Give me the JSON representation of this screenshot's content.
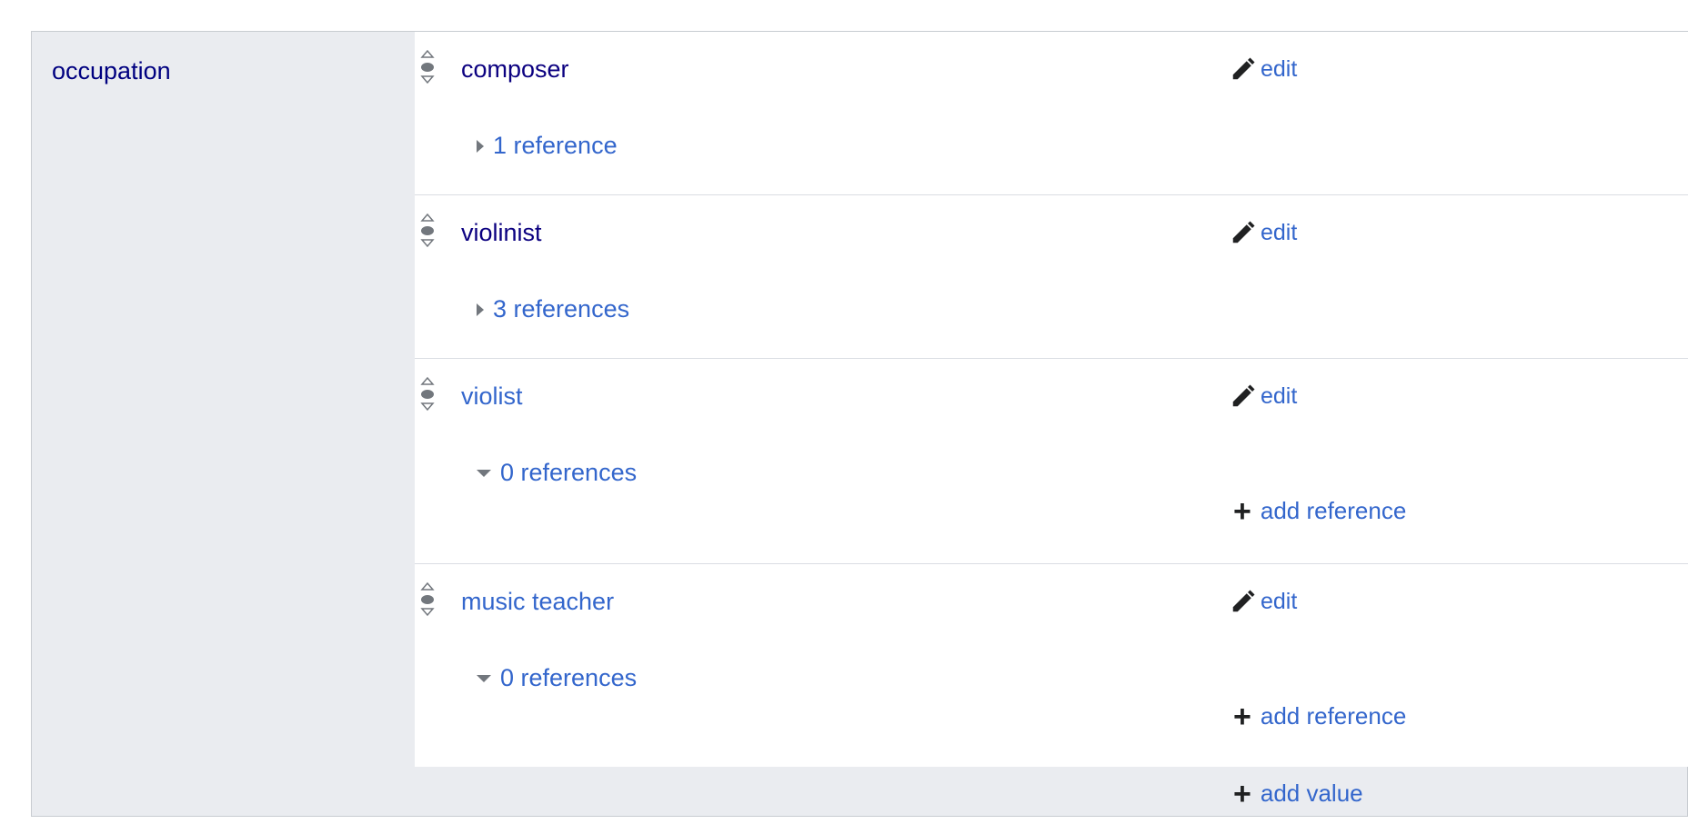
{
  "property": {
    "name": "occupation"
  },
  "statements": [
    {
      "value": "composer",
      "edit_label": "edit",
      "references_label": "1 reference",
      "references_expanded": false,
      "visited": true
    },
    {
      "value": "violinist",
      "edit_label": "edit",
      "references_label": "3 references",
      "references_expanded": false,
      "visited": true
    },
    {
      "value": "violist",
      "edit_label": "edit",
      "references_label": "0 references",
      "references_expanded": true,
      "add_reference_label": "add reference",
      "visited": false
    },
    {
      "value": "music teacher",
      "edit_label": "edit",
      "references_label": "0 references",
      "references_expanded": true,
      "add_reference_label": "add reference",
      "visited": false
    }
  ],
  "add_value_label": "add value",
  "colors": {
    "link": "#3366cc",
    "visited_link": "#0b0080",
    "property_link": "#000080",
    "group_background": "#eaecf0",
    "border": "#c8ccd1",
    "icon": "#202122"
  },
  "icons": {
    "edit": "pencil-icon",
    "rank": "rank-selector-icon",
    "add": "plus-icon",
    "collapsed": "triangle-right-icon",
    "expanded": "triangle-down-icon"
  }
}
